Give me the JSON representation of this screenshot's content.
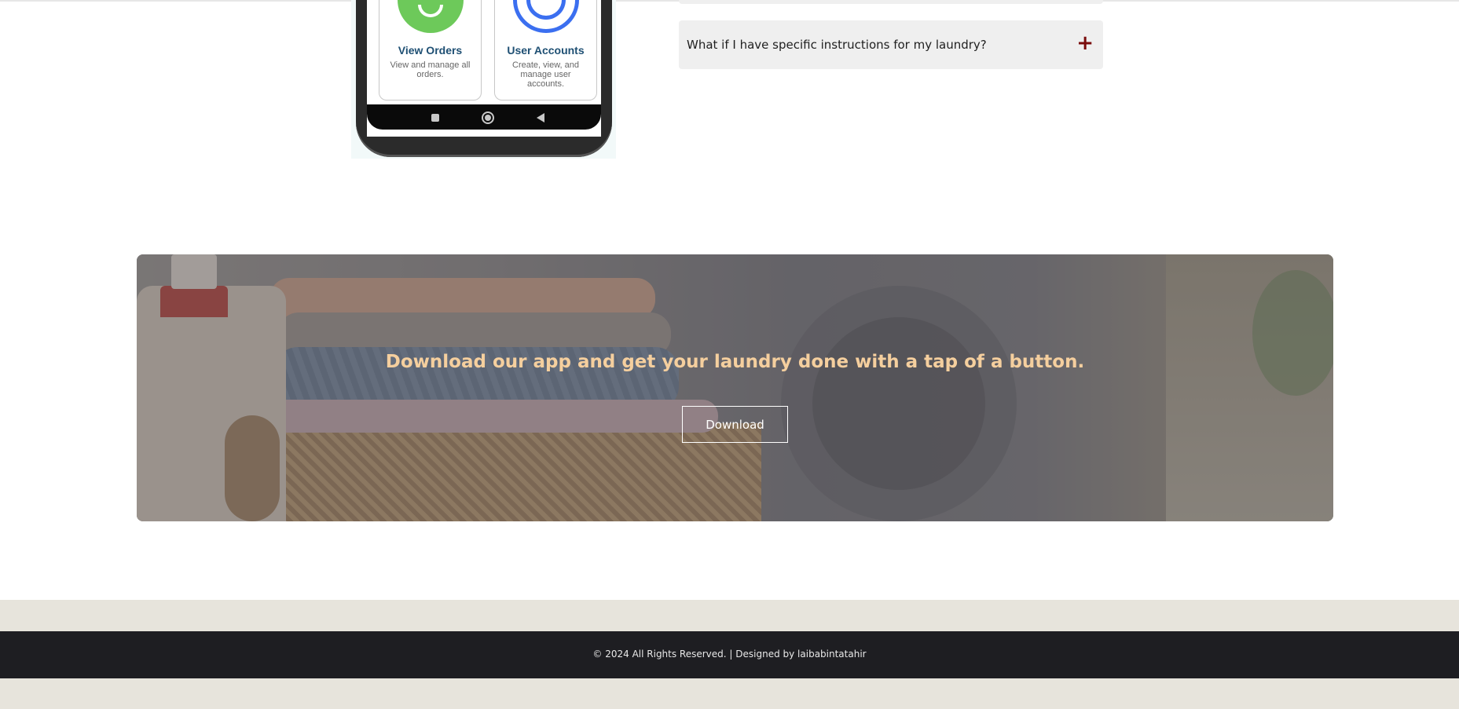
{
  "phone": {
    "cards": [
      {
        "title": "View Orders",
        "description": "View and manage all orders."
      },
      {
        "title": "User Accounts",
        "description": "Create, view, and manage user accounts."
      }
    ]
  },
  "faq": {
    "items": [
      {
        "question": "What if I have specific instructions for my laundry?",
        "toggle": "+"
      }
    ]
  },
  "banner": {
    "heading": "Download our app and get your laundry done with a tap of a button.",
    "button_label": "Download"
  },
  "footer": {
    "text": "© 2024 All Rights Reserved. | Designed by laibabintatahir"
  },
  "colors": {
    "accent": "#7a0c0c",
    "heading": "#f5cf9e",
    "footer_bg": "#1e1e22",
    "footer_strip": "#e7e4dc",
    "faq_bg": "#efefef"
  },
  "icons": [
    "eye-icon",
    "user-icon",
    "nav-recent-icon",
    "nav-home-icon",
    "nav-back-icon",
    "plus-icon"
  ]
}
